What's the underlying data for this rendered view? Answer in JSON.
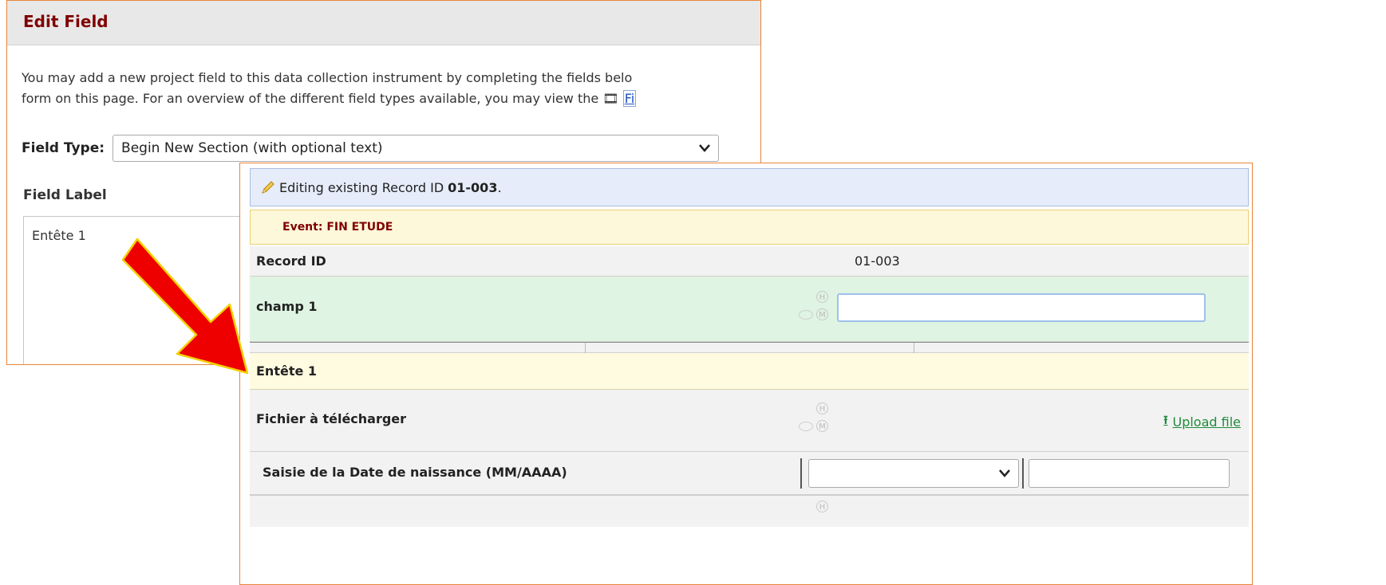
{
  "edit_field": {
    "title": "Edit Field",
    "intro_line1": "You may add a new project field to this data collection instrument by completing the fields belo",
    "intro_line2_prefix": "form on this page. For an overview of the different field types available, you may view the ",
    "intro_link": "Fi",
    "field_type_label": "Field Type:",
    "field_type_value": "Begin New Section (with optional text)",
    "field_label_heading": "Field Label",
    "field_label_value": "Entête 1"
  },
  "record_form": {
    "editing_prefix": "Editing existing Record ID",
    "record_id_bold": "01-003",
    "editing_suffix": ".",
    "event_text": "Event: FIN ETUDE",
    "rows": {
      "record_id_label": "Record ID",
      "record_id_value": "01-003",
      "champ_label": "champ 1",
      "champ_value": "",
      "section_header": "Entête 1",
      "fichier_label": "Fichier à télécharger",
      "upload_label": "Upload file",
      "date_label": "Saisie de la Date de naissance (MM/AAAA)",
      "date_month_value": "",
      "date_year_value": ""
    },
    "icon_letters": {
      "h": "H",
      "m": "M"
    }
  },
  "colors": {
    "edit_title": "#800000",
    "panel_border": "#e8853a",
    "banner_bg": "#e6ecf9",
    "event_bg": "#fcf8d9",
    "champ_bg": "#dff4e2",
    "section_bg": "#fefbe0",
    "upload_link": "#1f8a3a",
    "arrow": "#ee0000"
  },
  "icons": [
    "pencil-icon",
    "film-icon",
    "chevron-down-icon",
    "history-icon",
    "missing-data-icon",
    "comment-icon",
    "upload-icon",
    "arrow-icon"
  ]
}
